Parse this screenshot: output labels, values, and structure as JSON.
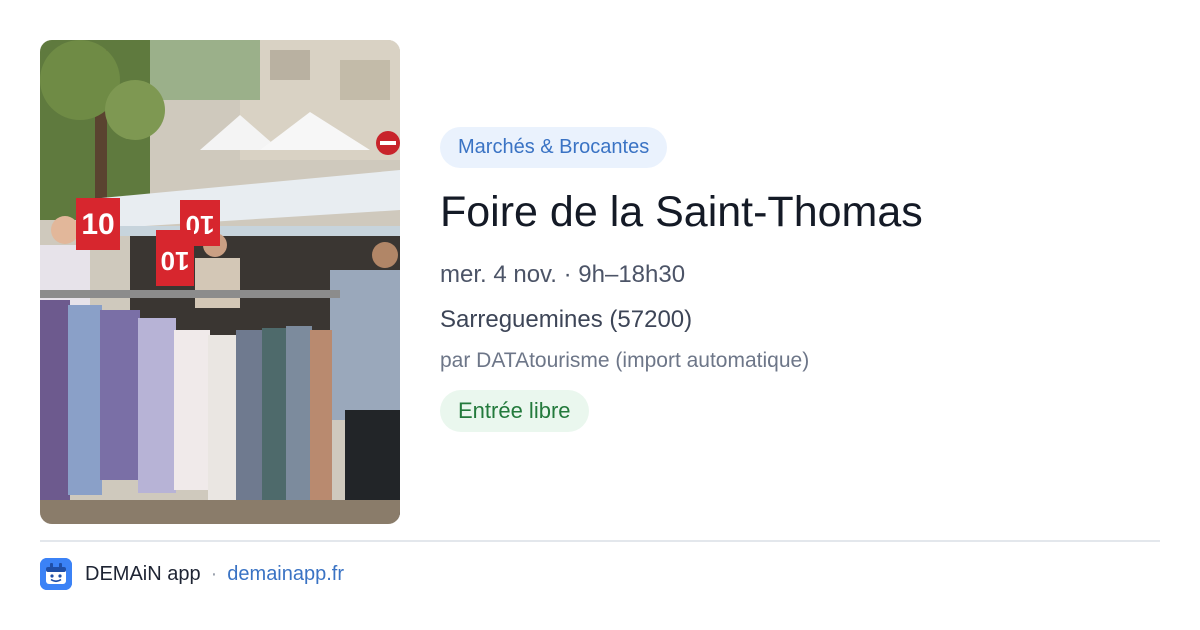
{
  "event": {
    "image_alt": "Étals de vêtements sur un marché en plein air",
    "price_tags": [
      "10",
      "10",
      "10"
    ],
    "category": "Marchés & Brocantes",
    "title": "Foire de la Saint-Thomas",
    "when": "mer. 4 nov. · 9h–18h30",
    "place": "Sarreguemines (57200)",
    "source": "par DATAtourisme (import automatique)",
    "price": "Entrée libre"
  },
  "footer": {
    "logo_icon": "demain-app-logo-icon",
    "app_name": "DEMAiN app",
    "separator": "·",
    "link": "demainapp.fr"
  },
  "colors": {
    "category_bg": "#eaf2fd",
    "category_text": "#3a73c4",
    "price_bg": "#eaf7ee",
    "price_text": "#237a3c",
    "link": "#3a73c4",
    "logo": "#3b82f6"
  }
}
